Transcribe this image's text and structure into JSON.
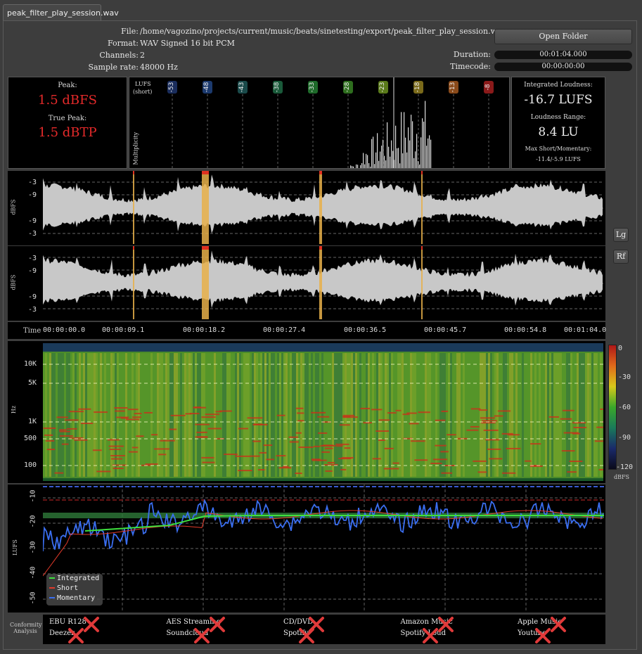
{
  "tab": {
    "label": "peak_filter_play_session.wav"
  },
  "file_info": {
    "file_label": "File:",
    "file_value": "/home/vagozino/projects/current/music/beats/sinetesting/export/peak_filter_play_session.wav",
    "format_label": "Format:",
    "format_value": "WAV Signed 16 bit PCM",
    "channels_label": "Channels:",
    "channels_value": "2",
    "sample_rate_label": "Sample rate:",
    "sample_rate_value": "48000 Hz",
    "open_folder": "Open Folder",
    "duration_label": "Duration:",
    "duration_value": "00:01:04.000",
    "timecode_label": "Timecode:",
    "timecode_value": "00:00:00:00"
  },
  "peak": {
    "peak_label": "Peak:",
    "peak_value": "1.5 dBFS",
    "true_peak_label": "True Peak:",
    "true_peak_value": "1.5 dBTP"
  },
  "histogram": {
    "lufs_label": "LUFS",
    "short_label": "(short)",
    "multiplicity_label": "Multiplicity",
    "markers": [
      {
        "label": "-53",
        "color": "#1a2d5c"
      },
      {
        "label": "-48",
        "color": "#1c3a6e"
      },
      {
        "label": "-43",
        "color": "#1a4a4a"
      },
      {
        "label": "-38",
        "color": "#1a5a3a"
      },
      {
        "label": "-33",
        "color": "#1e6a2a"
      },
      {
        "label": "-28",
        "color": "#2e6e1e"
      },
      {
        "label": "-23",
        "color": "#5a7a1a"
      },
      {
        "label": "-18",
        "color": "#7a6a1a"
      },
      {
        "label": "-13",
        "color": "#8a4a1a"
      },
      {
        "label": "-8",
        "color": "#8a1a1a"
      }
    ]
  },
  "loudness": {
    "integrated_label": "Integrated Loudness:",
    "integrated_value": "-16.7 LUFS",
    "range_label": "Loudness Range:",
    "range_value": "8.4 LU",
    "max_label": "Max Short/Momentary:",
    "max_value": "-11.4/-5.9 LUFS"
  },
  "waveform": {
    "ylabel": "dBFS",
    "ticks": [
      "-3",
      "-9",
      "-9",
      "-3"
    ],
    "lg_button": "Lg",
    "rf_button": "Rf"
  },
  "timeline": {
    "label": "Time",
    "ticks": [
      "00:00:00.0",
      "00:00:09.1",
      "00:00:18.2",
      "00:00:27.4",
      "00:00:36.5",
      "00:00:45.7",
      "00:00:54.8",
      "00:01:04.0"
    ]
  },
  "spectrogram": {
    "ylabel": "Hz",
    "ticks": [
      "10K",
      "5K",
      "1K",
      "500",
      "100"
    ],
    "scale_ticks": [
      "0",
      "-30",
      "-60",
      "-90",
      "-120"
    ],
    "scale_unit": "dBFS"
  },
  "loudness_graph": {
    "ylabel": "LUFS",
    "ticks": [
      "-10",
      "-20",
      "-30",
      "-40",
      "-50"
    ],
    "legend": [
      {
        "label": "Integrated",
        "color": "#3ee03e"
      },
      {
        "label": "Short",
        "color": "#e23a2a"
      },
      {
        "label": "Momentary",
        "color": "#3a6ef0"
      }
    ]
  },
  "conformity": {
    "title_line1": "Conformity",
    "title_line2": "Analysis",
    "columns": [
      {
        "top": "EBU R128",
        "bottom": "Deezer"
      },
      {
        "top": "AES Streaming",
        "bottom": "Soundcloud"
      },
      {
        "top": "CD/DVD",
        "bottom": "Spotify"
      },
      {
        "top": "Amazon Music",
        "bottom": "Spotify Loud"
      },
      {
        "top": "Apple Music",
        "bottom": "Youtube"
      }
    ],
    "status_icon": "cross-icon"
  }
}
